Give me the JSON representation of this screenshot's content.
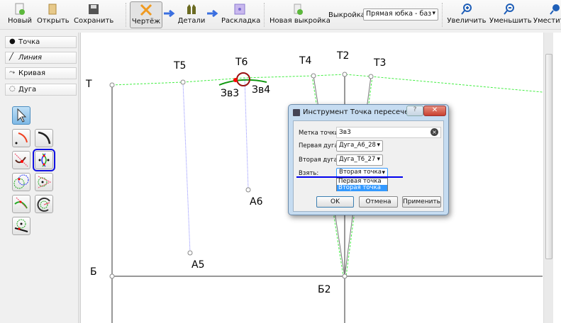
{
  "toolbar": {
    "new": "Новый",
    "open": "Открыть",
    "save": "Сохранить",
    "draw": "Чертёж",
    "details": "Детали",
    "layout": "Раскладка",
    "new_pattern": "Новая выкройка",
    "pattern_label": "Выкройка:",
    "pattern_value": "Прямая юбка - баз",
    "zoom_in": "Увеличить",
    "zoom_out": "Уменьшить",
    "fit": "Уместить"
  },
  "left_panel": {
    "tabs": [
      {
        "label": "Точка"
      },
      {
        "label": "Линия"
      },
      {
        "label": "Кривая"
      },
      {
        "label": "Дуга"
      }
    ]
  },
  "canvas": {
    "points": {
      "T": "Т",
      "T5": "Т5",
      "T6": "Т6",
      "T4": "Т4",
      "T2": "Т2",
      "T3": "Т3",
      "Zv3": "Зв3",
      "Zv4": "Зв4",
      "A6": "А6",
      "A5": "А5",
      "B": "Б",
      "B2": "Б2"
    }
  },
  "dialog": {
    "title": "Инструмент Точка пересечения...",
    "point_label": "Метка точки:",
    "point_value": "Зв3",
    "first_arc_label": "Первая дуга:",
    "first_arc_value": "Дуга_А6_28",
    "second_arc_label": "Вторая дуга:",
    "second_arc_value": "Дуга_Т6_27",
    "take_label": "Взять:",
    "take_value": "Вторая точка",
    "take_options": [
      "Первая точка",
      "Вторая точка"
    ],
    "ok": "OK",
    "cancel": "Отмена",
    "apply": "Применить"
  },
  "colors": {
    "accent": "#3399ff",
    "highlight": "#0000ee",
    "guide": "#44ee44"
  }
}
